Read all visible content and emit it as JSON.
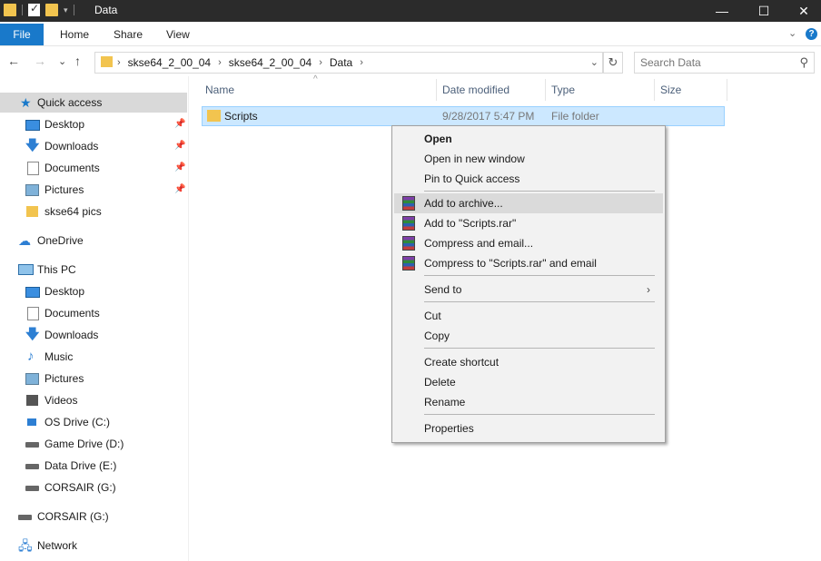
{
  "window": {
    "title": "Data",
    "controls": {
      "minimize": "—",
      "maximize": "☐",
      "close": "✕"
    }
  },
  "ribbon": {
    "file": "File",
    "tabs": [
      "Home",
      "Share",
      "View"
    ],
    "collapse": "⌄",
    "help": "?"
  },
  "address": {
    "back": "←",
    "forward": "→",
    "recent": "⌄",
    "up": "↑",
    "crumbs": [
      "skse64_2_00_04",
      "skse64_2_00_04",
      "Data"
    ],
    "crumb_sep": "›",
    "dropdown": "⌄",
    "refresh": "↻",
    "search_placeholder": "Search Data",
    "search_icon": "search-icon"
  },
  "nav": {
    "quick_access": "Quick access",
    "qa_items": [
      {
        "label": "Desktop",
        "icon": "desktop-icon",
        "pinned": true
      },
      {
        "label": "Downloads",
        "icon": "downloads-icon",
        "pinned": true
      },
      {
        "label": "Documents",
        "icon": "documents-icon",
        "pinned": true
      },
      {
        "label": "Pictures",
        "icon": "pictures-icon",
        "pinned": true
      },
      {
        "label": "skse64 pics",
        "icon": "folder-icon",
        "pinned": false
      }
    ],
    "onedrive": "OneDrive",
    "this_pc": "This PC",
    "pc_items": [
      {
        "label": "Desktop",
        "icon": "desktop-icon"
      },
      {
        "label": "Documents",
        "icon": "documents-icon"
      },
      {
        "label": "Downloads",
        "icon": "downloads-icon"
      },
      {
        "label": "Music",
        "icon": "music-icon"
      },
      {
        "label": "Pictures",
        "icon": "pictures-icon"
      },
      {
        "label": "Videos",
        "icon": "videos-icon"
      },
      {
        "label": "OS Drive (C:)",
        "icon": "os-drive-icon"
      },
      {
        "label": "Game Drive (D:)",
        "icon": "drive-icon"
      },
      {
        "label": "Data Drive (E:)",
        "icon": "drive-icon"
      },
      {
        "label": "CORSAIR (G:)",
        "icon": "drive-icon"
      }
    ],
    "corsair": "CORSAIR (G:)",
    "network": "Network"
  },
  "columns": {
    "name": "Name",
    "date": "Date modified",
    "type": "Type",
    "size": "Size",
    "sort": "^"
  },
  "file": {
    "name": "Scripts",
    "date": "9/28/2017 5:47 PM",
    "type": "File folder"
  },
  "context_menu": {
    "open": "Open",
    "open_new_window": "Open in new window",
    "pin_quick_access": "Pin to Quick access",
    "add_archive": "Add to archive...",
    "add_rar": "Add to \"Scripts.rar\"",
    "compress_email": "Compress and email...",
    "compress_rar_email": "Compress to \"Scripts.rar\" and email",
    "send_to": "Send to",
    "send_arrow": "›",
    "cut": "Cut",
    "copy": "Copy",
    "create_shortcut": "Create shortcut",
    "delete": "Delete",
    "rename": "Rename",
    "properties": "Properties"
  }
}
